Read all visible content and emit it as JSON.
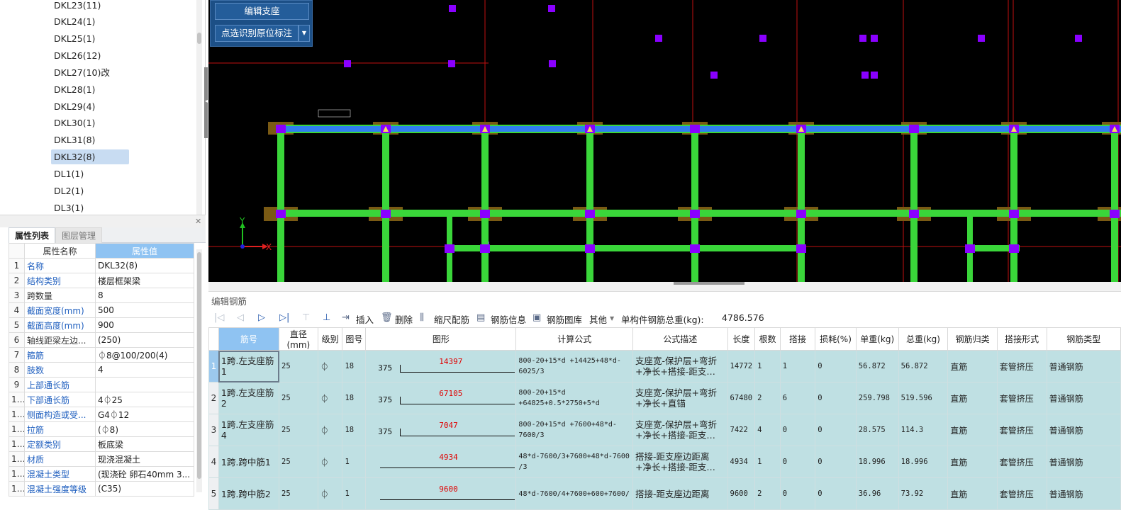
{
  "tree": {
    "items": [
      "DKL23(11)",
      "DKL24(1)",
      "DKL25(1)",
      "DKL26(12)",
      "DKL27(10)改",
      "DKL28(1)",
      "DKL29(4)",
      "DKL30(1)",
      "DKL31(8)",
      "DKL32(8)",
      "DL1(1)",
      "DL2(1)",
      "DL3(1)"
    ],
    "selected_index": 9
  },
  "property_panel": {
    "tabs": [
      "属性列表",
      "图层管理"
    ],
    "header": {
      "name": "属性名称",
      "value": "属性值"
    },
    "rows": [
      {
        "idx": "1",
        "name": "名称",
        "value": "DKL32(8)"
      },
      {
        "idx": "2",
        "name": "结构类别",
        "value": "楼层框架梁"
      },
      {
        "idx": "3",
        "name": "跨数量",
        "value": "8"
      },
      {
        "idx": "4",
        "name": "截面宽度(mm)",
        "value": "500"
      },
      {
        "idx": "5",
        "name": "截面高度(mm)",
        "value": "900"
      },
      {
        "idx": "6",
        "name": "轴线距梁左边...",
        "value": "(250)"
      },
      {
        "idx": "7",
        "name": "箍筋",
        "value": "⏀8@100/200(4)"
      },
      {
        "idx": "8",
        "name": "肢数",
        "value": "4"
      },
      {
        "idx": "9",
        "name": "上部通长筋",
        "value": ""
      },
      {
        "idx": "10",
        "name": "下部通长筋",
        "value": "4⏀25"
      },
      {
        "idx": "11",
        "name": "侧面构造或受...",
        "value": "G4⏀12"
      },
      {
        "idx": "12",
        "name": "拉筋",
        "value": "(⏀8)"
      },
      {
        "idx": "13",
        "name": "定额类别",
        "value": "板底梁"
      },
      {
        "idx": "14",
        "name": "材质",
        "value": "现浇混凝土"
      },
      {
        "idx": "15",
        "name": "混凝土类型",
        "value": "(现浇砼 卵石40mm 3..."
      },
      {
        "idx": "16",
        "name": "混凝土强度等级",
        "value": "(C35)"
      }
    ],
    "blue_name_rows": [
      1,
      2,
      4,
      5,
      7,
      8,
      9,
      10,
      11,
      12,
      13,
      14,
      15,
      16
    ]
  },
  "cad": {
    "buttons": {
      "edit_support": "编辑支座",
      "pick_label": "点选识别原位标注"
    },
    "axis": {
      "x": "X",
      "y": "Y"
    },
    "colors": {
      "beam": "#3ad63a",
      "top_beam": "#2f7ff0",
      "node": "#8a00ff",
      "axis_line": "#c01010",
      "support": "#7a5a14"
    }
  },
  "rebar_editor": {
    "title": "编辑钢筋",
    "toolbar": {
      "insert": "插入",
      "delete": "删除",
      "scale_rebar": "缩尺配筋",
      "rebar_info": "钢筋信息",
      "rebar_library": "钢筋图库",
      "other": "其他",
      "total_weight_label": "单构件钢筋总重(kg):",
      "total_weight_value": "4786.576"
    },
    "columns": [
      "筋号",
      "直径(mm)",
      "级别",
      "图号",
      "图形",
      "计算公式",
      "公式描述",
      "长度",
      "根数",
      "搭接",
      "损耗(%)",
      "单重(kg)",
      "总重(kg)",
      "钢筋归类",
      "搭接形式",
      "钢筋类型"
    ],
    "rows": [
      {
        "no": "1",
        "name": "1跨.左支座筋1",
        "dia": "25",
        "grade": "⏀",
        "fig": "18",
        "shape_left": "375",
        "shape_value": "14397",
        "formula": "800-20+15*d +14425+48*d-6025/3",
        "desc": "支座宽-保护层+弯折+净长+搭接-距支…",
        "length": "14772",
        "count": "1",
        "lap": "1",
        "loss": "0",
        "unit_w": "56.872",
        "total_w": "56.872",
        "cls": "直筋",
        "lap_form": "套管挤压",
        "type": "普通钢筋"
      },
      {
        "no": "2",
        "name": "1跨.左支座筋2",
        "dia": "25",
        "grade": "⏀",
        "fig": "18",
        "shape_left": "375",
        "shape_value": "67105",
        "formula": "800-20+15*d +64825+0.5*2750+5*d",
        "desc": "支座宽-保护层+弯折+净长+直锚",
        "length": "67480",
        "count": "2",
        "lap": "6",
        "loss": "0",
        "unit_w": "259.798",
        "total_w": "519.596",
        "cls": "直筋",
        "lap_form": "套管挤压",
        "type": "普通钢筋"
      },
      {
        "no": "3",
        "name": "1跨.左支座筋4",
        "dia": "25",
        "grade": "⏀",
        "fig": "18",
        "shape_left": "375",
        "shape_value": "7047",
        "formula": "800-20+15*d +7600+48*d-7600/3",
        "desc": "支座宽-保护层+弯折+净长+搭接-距支…",
        "length": "7422",
        "count": "4",
        "lap": "0",
        "loss": "0",
        "unit_w": "28.575",
        "total_w": "114.3",
        "cls": "直筋",
        "lap_form": "套管挤压",
        "type": "普通钢筋"
      },
      {
        "no": "4",
        "name": "1跨.跨中筋1",
        "dia": "25",
        "grade": "⏀",
        "fig": "1",
        "shape_left": "",
        "shape_value": "4934",
        "formula": "48*d-7600/3+7600+48*d-7600 /3",
        "desc": "搭接-距支座边距离+净长+搭接-距支…",
        "length": "4934",
        "count": "1",
        "lap": "0",
        "loss": "0",
        "unit_w": "18.996",
        "total_w": "18.996",
        "cls": "直筋",
        "lap_form": "套管挤压",
        "type": "普通钢筋"
      },
      {
        "no": "5",
        "name": "1跨.跨中筋2",
        "dia": "25",
        "grade": "⏀",
        "fig": "1",
        "shape_left": "",
        "shape_value": "9600",
        "formula": "48*d-7600/4+7600+600+7600/",
        "desc": "搭接-距支座边距离",
        "length": "9600",
        "count": "2",
        "lap": "0",
        "loss": "0",
        "unit_w": "36.96",
        "total_w": "73.92",
        "cls": "直筋",
        "lap_form": "套管挤压",
        "type": "普通钢筋"
      }
    ]
  }
}
